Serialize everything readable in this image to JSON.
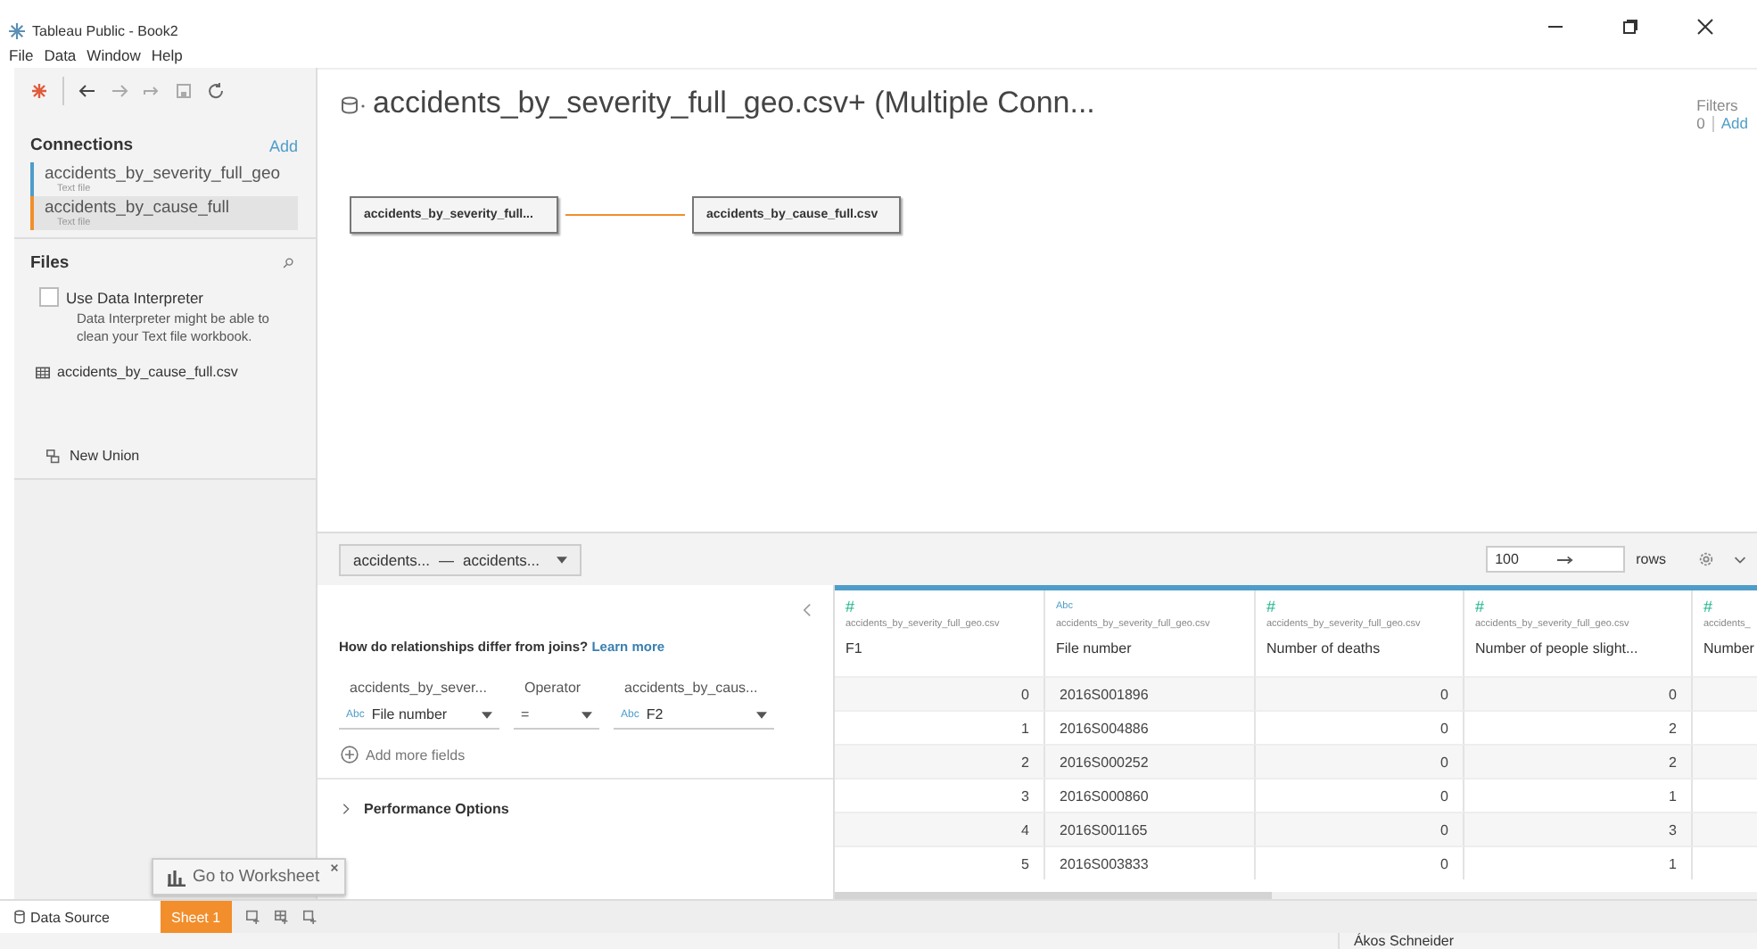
{
  "window": {
    "title": "Tableau Public - Book2"
  },
  "menu": [
    "File",
    "Data",
    "Window",
    "Help"
  ],
  "connections": {
    "heading": "Connections",
    "add": "Add",
    "items": [
      {
        "name": "accidents_by_severity_full_geo",
        "type": "Text file",
        "selected": false,
        "color": "#4e9dc9"
      },
      {
        "name": "accidents_by_cause_full",
        "type": "Text file",
        "selected": true,
        "color": "#f28e2b"
      }
    ]
  },
  "files": {
    "heading": "Files",
    "interpreter": {
      "label": "Use Data Interpreter",
      "checked": false,
      "note": "Data Interpreter might be able to clean your Text file workbook."
    },
    "items": [
      "accidents_by_cause_full.csv"
    ],
    "new_union": "New Union"
  },
  "datasource": {
    "title": "accidents_by_severity_full_geo.csv+ (Multiple Conn...",
    "filters_label": "Filters",
    "filters_count": "0",
    "filters_add": "Add",
    "nodes": [
      "accidents_by_severity_full...",
      "accidents_by_cause_full.csv"
    ]
  },
  "relationship": {
    "selector": [
      "accidents...",
      "—",
      "accidents..."
    ],
    "question": "How do relationships differ from joins?",
    "learn_more": "Learn more",
    "headers": [
      "accidents_by_sever...",
      "Operator",
      "accidents_by_caus..."
    ],
    "left_field": {
      "type": "Abc",
      "value": "File number"
    },
    "operator": "=",
    "right_field": {
      "type": "Abc",
      "value": "F2"
    },
    "add_fields": "Add more fields",
    "performance": "Performance Options"
  },
  "grid": {
    "rows_count": "100",
    "rows_label": "rows",
    "columns": [
      {
        "kind": "number",
        "type": "#",
        "source": "accidents_by_severity_full_geo.csv",
        "name": "F1"
      },
      {
        "kind": "text",
        "type": "Abc",
        "source": "accidents_by_severity_full_geo.csv",
        "name": "File number"
      },
      {
        "kind": "number",
        "type": "#",
        "source": "accidents_by_severity_full_geo.csv",
        "name": "Number of deaths"
      },
      {
        "kind": "number",
        "type": "#",
        "source": "accidents_by_severity_full_geo.csv",
        "name": "Number of people slight..."
      },
      {
        "kind": "number",
        "type": "#",
        "source": "accidents_",
        "name": "Number"
      }
    ],
    "rows": [
      [
        "0",
        "2016S001896",
        "0",
        "0"
      ],
      [
        "1",
        "2016S004886",
        "0",
        "2"
      ],
      [
        "2",
        "2016S000252",
        "0",
        "2"
      ],
      [
        "3",
        "2016S000860",
        "0",
        "1"
      ],
      [
        "4",
        "2016S001165",
        "0",
        "3"
      ],
      [
        "5",
        "2016S003833",
        "0",
        "1"
      ]
    ]
  },
  "tooltip": "Go to Worksheet",
  "tabs": [
    {
      "label": "Data Source",
      "selected": false
    },
    {
      "label": "Sheet 1",
      "selected": true
    }
  ],
  "status": {
    "user": "Ákos Schneider"
  }
}
